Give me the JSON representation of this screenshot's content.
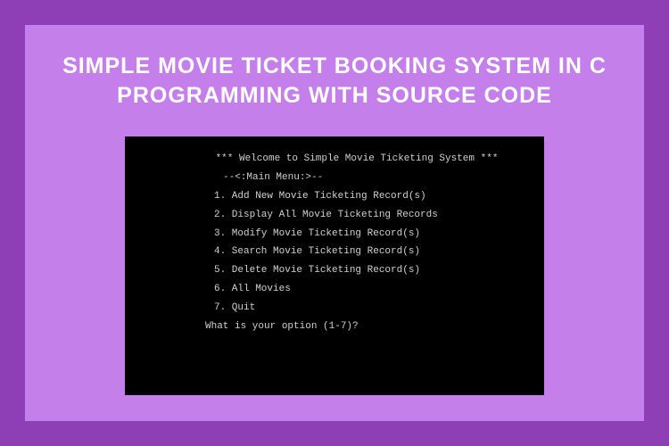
{
  "title": "SIMPLE MOVIE TICKET BOOKING SYSTEM IN C PROGRAMMING WITH SOURCE CODE",
  "terminal": {
    "welcome": "*** Welcome to Simple Movie Ticketing System ***",
    "menu_header": "--<:Main Menu:>--",
    "items": [
      "1. Add New Movie Ticketing Record(s)",
      "2. Display All Movie Ticketing Records",
      "3. Modify Movie Ticketing Record(s)",
      "4. Search Movie Ticketing Record(s)",
      "5. Delete Movie Ticketing Record(s)",
      "6. All Movies",
      "7. Quit"
    ],
    "prompt": "What is your option (1-7)?"
  }
}
